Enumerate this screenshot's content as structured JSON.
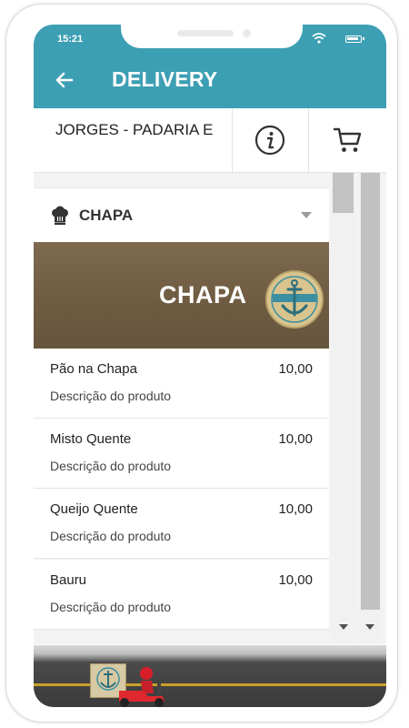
{
  "status_bar": {
    "time": "15:21"
  },
  "app_bar": {
    "title": "DELIVERY"
  },
  "store": {
    "name": "JORGES - PADARIA E"
  },
  "category": {
    "title": "CHAPA",
    "banner_text": "CHAPA"
  },
  "products": [
    {
      "name": "Pão na Chapa",
      "price": "10,00",
      "description": "Descrição do produto"
    },
    {
      "name": "Misto Quente",
      "price": "10,00",
      "description": "Descrição do produto"
    },
    {
      "name": "Queijo Quente",
      "price": "10,00",
      "description": "Descrição do produto"
    },
    {
      "name": "Bauru",
      "price": "10,00",
      "description": "Descrição do produto"
    }
  ],
  "icons": {
    "back": "arrow-left",
    "info": "info-circle",
    "cart": "shopping-cart",
    "category": "chef-hat",
    "collapse": "triangle-down",
    "wifi": "wifi",
    "battery": "battery"
  },
  "colors": {
    "primary": "#3d9fb3",
    "banner_wood": "#6f5c42",
    "road_stripe": "#caa02a"
  }
}
